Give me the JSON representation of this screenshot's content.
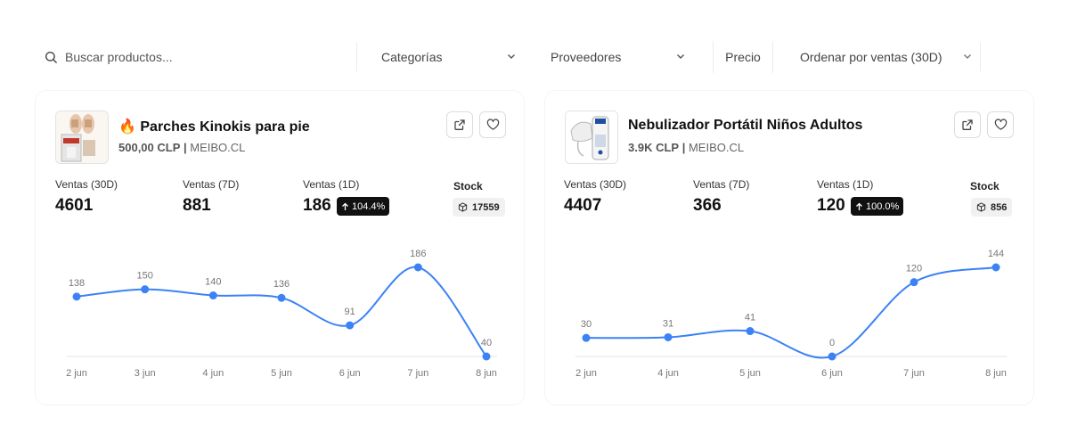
{
  "filters": {
    "search_placeholder": "Buscar productos...",
    "categories": "Categorías",
    "providers": "Proveedores",
    "price": "Precio",
    "sort": "Ordenar por ventas (30D)"
  },
  "cards": [
    {
      "emoji": "🔥",
      "title": "Parches Kinokis para pie",
      "price": "500,00 CLP",
      "separator": "|",
      "store": "MEIBO.CL",
      "stats": [
        {
          "label": "Ventas (30D)",
          "value": "4601"
        },
        {
          "label": "Ventas (7D)",
          "value": "881"
        },
        {
          "label": "Ventas (1D)",
          "value": "186"
        }
      ],
      "change_badge": "104.4%",
      "stock_label": "Stock",
      "stock_value": "17559",
      "chart_data": {
        "type": "line",
        "x": [
          "2 jun",
          "3 jun",
          "4 jun",
          "5 jun",
          "6 jun",
          "7 jun",
          "8 jun"
        ],
        "values": [
          138,
          150,
          140,
          136,
          91,
          186,
          40
        ],
        "line_color": "#3b82f6"
      }
    },
    {
      "emoji": "",
      "title": "Nebulizador Portátil Niños Adultos",
      "price": "3.9K CLP",
      "separator": "|",
      "store": "MEIBO.CL",
      "stats": [
        {
          "label": "Ventas (30D)",
          "value": "4407"
        },
        {
          "label": "Ventas (7D)",
          "value": "366"
        },
        {
          "label": "Ventas (1D)",
          "value": "120"
        }
      ],
      "change_badge": "100.0%",
      "stock_label": "Stock",
      "stock_value": "856",
      "chart_data": {
        "type": "line",
        "x": [
          "2 jun",
          "4 jun",
          "5 jun",
          "6 jun",
          "7 jun",
          "8 jun"
        ],
        "values": [
          30,
          31,
          41,
          0,
          120,
          144
        ],
        "line_color": "#3b82f6"
      }
    }
  ]
}
